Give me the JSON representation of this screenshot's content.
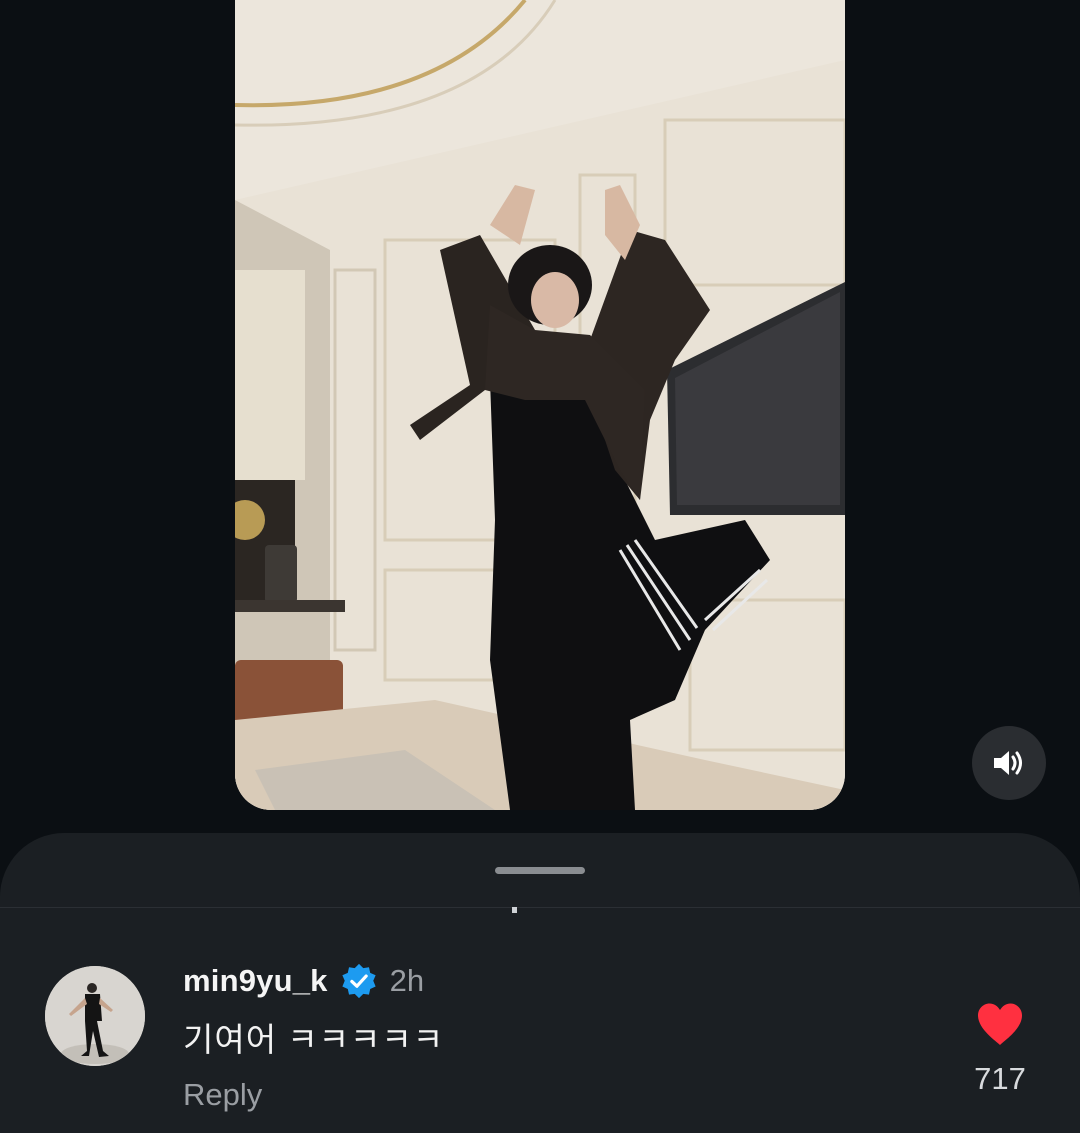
{
  "video": {
    "image_description_icon": "video-frame",
    "mute_icon": "speaker-volume-icon"
  },
  "sheet": {
    "handle_icon": "drag-handle"
  },
  "comment": {
    "username": "min9yu_k",
    "verified_icon": "verified-badge-icon",
    "timestamp": "2h",
    "text": "기여어 ㅋㅋㅋㅋㅋ",
    "reply_label": "Reply",
    "like_icon": "heart-icon",
    "like_count": "717"
  },
  "colors": {
    "background": "#0b0f13",
    "sheet": "#1b1f23",
    "verified": "#1d9bf0",
    "heart": "#ff3040",
    "muted_text": "#9a9ea3"
  }
}
